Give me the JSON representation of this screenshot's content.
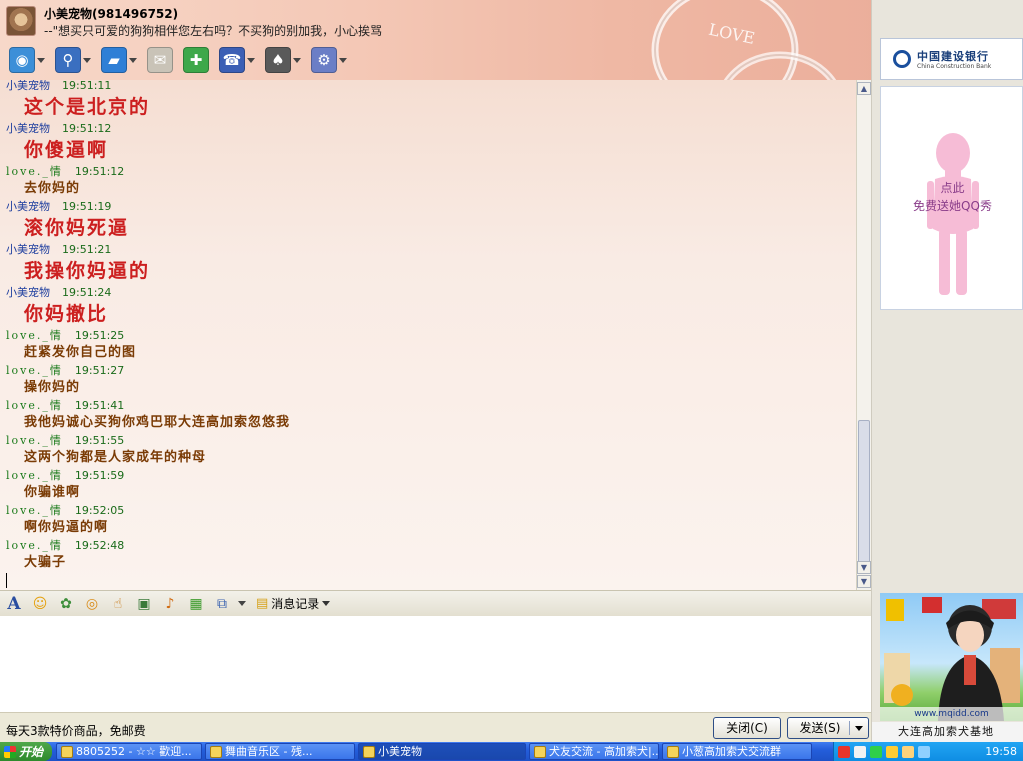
{
  "window": {
    "contact_name": "小美宠物(981496752)",
    "signature": "--\"想买只可爱的狗狗相伴您左右吗？不买狗的别加我，小心挨骂",
    "ring_text": "LOVE"
  },
  "toolbar": {
    "items": [
      {
        "icon": "video-icon",
        "color": "#3c8fd8"
      },
      {
        "icon": "microphone-icon",
        "color": "#3a6fc0"
      },
      {
        "icon": "folder-icon",
        "color": "#2f7fd6"
      },
      {
        "icon": "mail-icon",
        "color": "#c9c3b7"
      },
      {
        "icon": "add-contact-icon",
        "color": "#3ea84a"
      },
      {
        "icon": "qq-service-icon",
        "color": "#3c5fb5"
      },
      {
        "icon": "game-icon",
        "color": "#5a5a5a"
      },
      {
        "icon": "settings-icon",
        "color": "#6b7ec6"
      }
    ]
  },
  "messages": [
    {
      "sender": "小美宠物",
      "time": "19:51:11",
      "text": "这个是北京的",
      "style": "big",
      "who": "a"
    },
    {
      "sender": "小美宠物",
      "time": "19:51:12",
      "text": "你傻逼啊",
      "style": "big",
      "who": "a"
    },
    {
      "sender": "love._情",
      "time": "19:51:12",
      "text": "去你妈的",
      "style": "small",
      "who": "b"
    },
    {
      "sender": "小美宠物",
      "time": "19:51:19",
      "text": "滚你妈死逼",
      "style": "big",
      "who": "a"
    },
    {
      "sender": "小美宠物",
      "time": "19:51:21",
      "text": "我操你妈逼的",
      "style": "big",
      "who": "a"
    },
    {
      "sender": "小美宠物",
      "time": "19:51:24",
      "text": "你妈撤比",
      "style": "big",
      "who": "a"
    },
    {
      "sender": "love._情",
      "time": "19:51:25",
      "text": "赶紧发你自己的图",
      "style": "small",
      "who": "b"
    },
    {
      "sender": "love._情",
      "time": "19:51:27",
      "text": "操你妈的",
      "style": "small",
      "who": "b"
    },
    {
      "sender": "love._情",
      "time": "19:51:41",
      "text": "我他妈诚心买狗你鸡巴耶大连高加索忽悠我",
      "style": "small",
      "who": "b"
    },
    {
      "sender": "love._情",
      "time": "19:51:55",
      "text": "这两个狗都是人家成年的种母",
      "style": "small",
      "who": "b"
    },
    {
      "sender": "love._情",
      "time": "19:51:59",
      "text": "你骗谁啊",
      "style": "small",
      "who": "b"
    },
    {
      "sender": "love._情",
      "time": "19:52:05",
      "text": "啊你妈逼的啊",
      "style": "small",
      "who": "b"
    },
    {
      "sender": "love._情",
      "time": "19:52:48",
      "text": "大骗子",
      "style": "small",
      "who": "b"
    }
  ],
  "input_toolbar": {
    "font_label": "A",
    "history_label": "消息记录"
  },
  "bottom": {
    "promo": "每天3款特价商品，免邮费",
    "close_label": "关闭(C)",
    "send_label": "发送(S)"
  },
  "right_panel": {
    "bank_name_cn": "中国建设银行",
    "bank_name_en": "China Construction Bank",
    "show_line1": "点此",
    "show_line2": "免费送她QQ秀",
    "ad_url": "www.mqidd.com",
    "watermark": "大连高加索犬基地"
  },
  "taskbar": {
    "start_label": "开始",
    "tasks": [
      {
        "label": "8805252 - ☆☆ 歡迎...",
        "active": false
      },
      {
        "label": "舞曲音乐区 - 残...",
        "active": false
      },
      {
        "label": "小美宠物",
        "active": true
      },
      {
        "label": "犬友交流 - 高加索犬|...",
        "active": false
      },
      {
        "label": "小葱高加索犬交流群",
        "active": false
      }
    ],
    "clock": "19:58"
  }
}
